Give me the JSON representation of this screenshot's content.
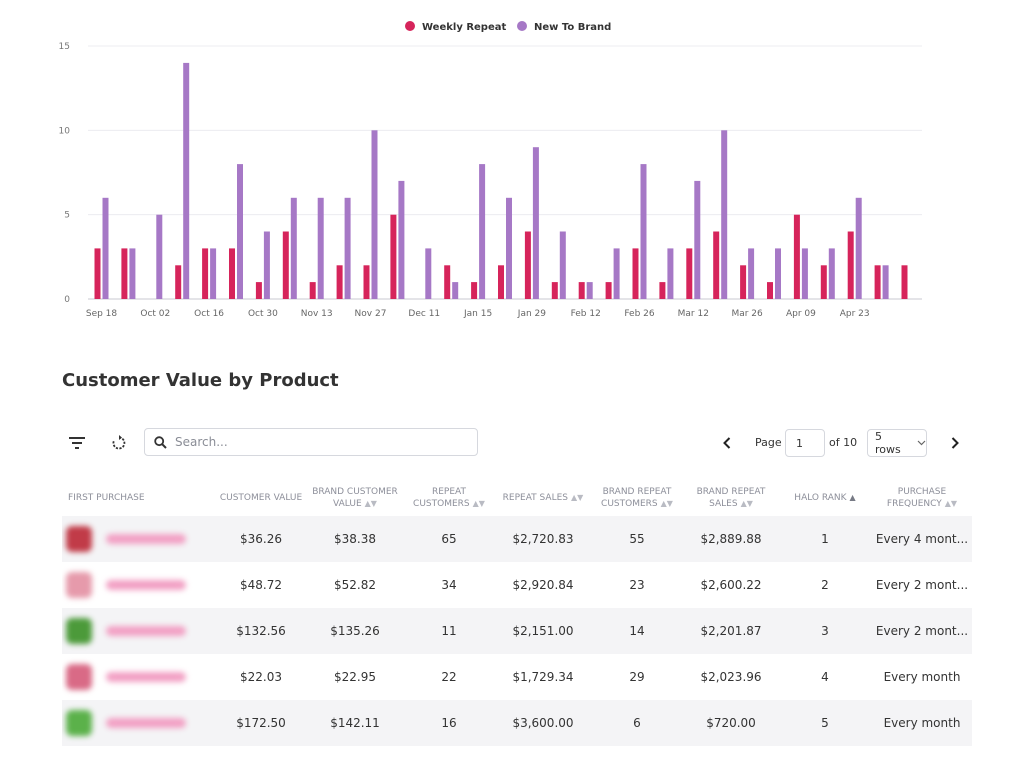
{
  "chart_data": {
    "type": "bar",
    "legend_position": "top-center",
    "grid": true,
    "ylim": [
      0,
      15
    ],
    "yticks": [
      "0",
      "5",
      "10",
      "15"
    ],
    "xtick_labels": [
      "Sep 18",
      "Oct 02",
      "Oct 16",
      "Oct 30",
      "Nov 13",
      "Nov 27",
      "Dec 11",
      "Jan 15",
      "Jan 29",
      "Feb 12",
      "Feb 26",
      "Mar 12",
      "Mar 26",
      "Apr 09",
      "Apr 23"
    ],
    "colors": {
      "Weekly Repeat": "#d6245b",
      "New To Brand": "#a678c6"
    },
    "series": [
      {
        "name": "Weekly Repeat",
        "values": [
          3,
          3,
          0,
          2,
          3,
          3,
          1,
          4,
          1,
          2,
          2,
          5,
          0,
          2,
          1,
          2,
          4,
          1,
          1,
          1,
          3,
          1,
          3,
          4,
          2,
          1,
          5,
          2,
          4,
          2,
          2
        ]
      },
      {
        "name": "New To Brand",
        "values": [
          6,
          3,
          5,
          14,
          3,
          8,
          4,
          6,
          6,
          6,
          10,
          7,
          3,
          1,
          8,
          6,
          9,
          4,
          1,
          3,
          8,
          3,
          7,
          10,
          3,
          3,
          3,
          3,
          6,
          2,
          0
        ]
      }
    ]
  },
  "section_title": "Customer Value by Product",
  "toolbar": {
    "filter_icon": "filter-icon",
    "refresh_icon": "refresh-icon",
    "search_placeholder": "Search...",
    "page_label": "Page",
    "page_value": "1",
    "page_of": "of 10",
    "rows_label": "5 rows"
  },
  "table": {
    "headers": [
      "First Purchase",
      "Customer Value",
      "Brand Customer Value",
      "Repeat Customers",
      "Repeat Sales",
      "Brand Repeat Customers",
      "Brand Repeat Sales",
      "Halo Rank",
      "Purchase Frequency"
    ],
    "rows": [
      {
        "thumb_color": "#c13b48",
        "cells": [
          "$36.26",
          "$38.38",
          "65",
          "$2,720.83",
          "55",
          "$2,889.88",
          "1",
          "Every 4 mont..."
        ]
      },
      {
        "thumb_color": "#e69aab",
        "cells": [
          "$48.72",
          "$52.82",
          "34",
          "$2,920.84",
          "23",
          "$2,600.22",
          "2",
          "Every 2 mont..."
        ]
      },
      {
        "thumb_color": "#4c9a3a",
        "cells": [
          "$132.56",
          "$135.26",
          "11",
          "$2,151.00",
          "14",
          "$2,201.87",
          "3",
          "Every 2 mont..."
        ]
      },
      {
        "thumb_color": "#d96a86",
        "cells": [
          "$22.03",
          "$22.95",
          "22",
          "$1,729.34",
          "29",
          "$2,023.96",
          "4",
          "Every month"
        ]
      },
      {
        "thumb_color": "#5bb14a",
        "cells": [
          "$172.50",
          "$142.11",
          "16",
          "$3,600.00",
          "6",
          "$720.00",
          "5",
          "Every month"
        ]
      }
    ]
  }
}
